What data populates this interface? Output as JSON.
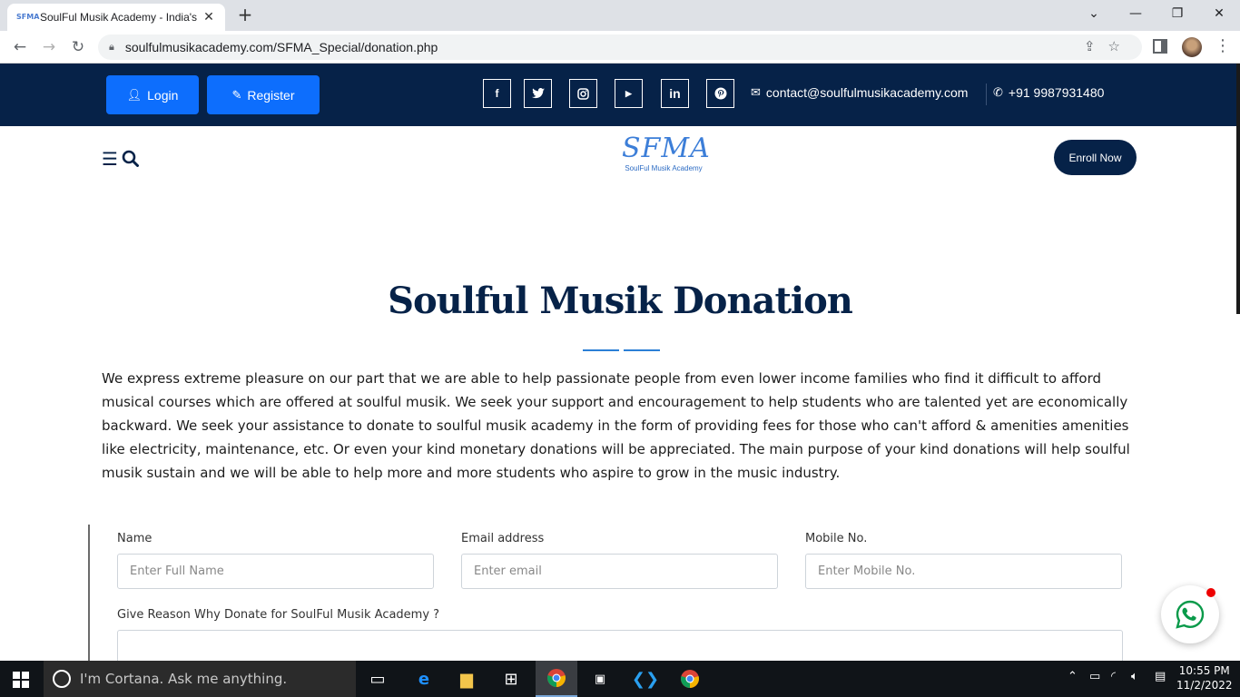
{
  "browser": {
    "tab_title": "SoulFul Musik Academy - India's",
    "favicon_text": "SFMA",
    "new_tab": "+",
    "url": "soulfulmusikacademy.com/SFMA_Special/donation.php"
  },
  "topbar": {
    "login_label": "Login",
    "register_label": "Register",
    "email": "contact@soulfulmusikacademy.com",
    "phone": "+91 9987931480",
    "bg_color": "#062248",
    "button_color": "#0d6efd"
  },
  "header": {
    "logo_mark": "SFMA",
    "logo_sub": "SoulFul Musik Academy",
    "enroll_label": "Enroll Now",
    "menu_icon": "☰"
  },
  "main": {
    "title": "Soulful Musik Donation",
    "intro": "We express extreme pleasure on our part that we are able to help passionate people from even lower income families who find it difficult to afford musical courses which are offered at soulful musik. We seek your support and encouragement to help students who are talented yet are economically backward. We seek your assistance to donate to soulful musik academy in the form of providing fees for those who can't afford & amenities amenities like electricity, maintenance, etc. Or even your kind monetary donations will be appreciated. The main purpose of your kind donations will help soulful musik sustain and we will be able to help more and more students who aspire to grow in the music industry."
  },
  "form": {
    "name_label": "Name",
    "name_placeholder": "Enter Full Name",
    "email_label": "Email address",
    "email_placeholder": "Enter email",
    "mobile_label": "Mobile No.",
    "mobile_placeholder": "Enter Mobile No.",
    "reason_label": "Give Reason Why Donate for SoulFul Musik Academy ?"
  },
  "taskbar": {
    "cortana_text": "I'm Cortana. Ask me anything.",
    "time": "10:55 PM",
    "date": "11/2/2022"
  }
}
